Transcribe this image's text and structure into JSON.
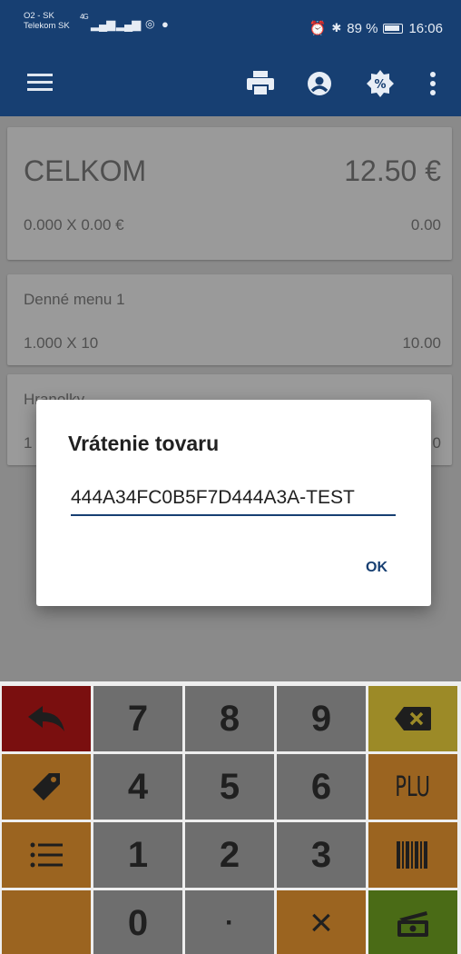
{
  "status_bar": {
    "carrier_line1": "O2 - SK",
    "carrier_line2": "Telekom SK",
    "network": "4G",
    "battery": "89 %",
    "time": "16:06"
  },
  "toolbar": {
    "icons": [
      "menu-icon",
      "printer-icon",
      "account-circle-icon",
      "discount-icon",
      "more-vert-icon"
    ]
  },
  "summary": {
    "total_label": "CELKOM",
    "total_value": "12.50 €",
    "line_qty": "0.000  X  0.00  €",
    "line_sum": "0.00"
  },
  "items": [
    {
      "name": "Denné menu 1",
      "qty": "1.000  X  10",
      "sum": "10.00"
    },
    {
      "name": "Hranolky",
      "qty": "1",
      "sum": "0"
    }
  ],
  "dialog": {
    "title": "Vrátenie tovaru",
    "input_value": "444A34FC0B5F7D444A3A-TEST",
    "ok_label": "OK"
  },
  "keypad": {
    "digits": [
      "7",
      "8",
      "9",
      "4",
      "5",
      "6",
      "1",
      "2",
      "3",
      "0"
    ],
    "dot_label": "·",
    "multiply_label": "×",
    "plu_label": "PLU",
    "icons": [
      "back-arrow-icon",
      "backspace-icon",
      "tag-icon",
      "list-icon",
      "barcode-icon",
      "cash-register-icon"
    ],
    "colors": {
      "red": "#7a0f0f",
      "orange": "#9b6420",
      "gray": "#6e6e6e",
      "yellow": "#9c8a27",
      "green": "#4a6b16"
    }
  },
  "theme": {
    "primary": "#173f72"
  }
}
